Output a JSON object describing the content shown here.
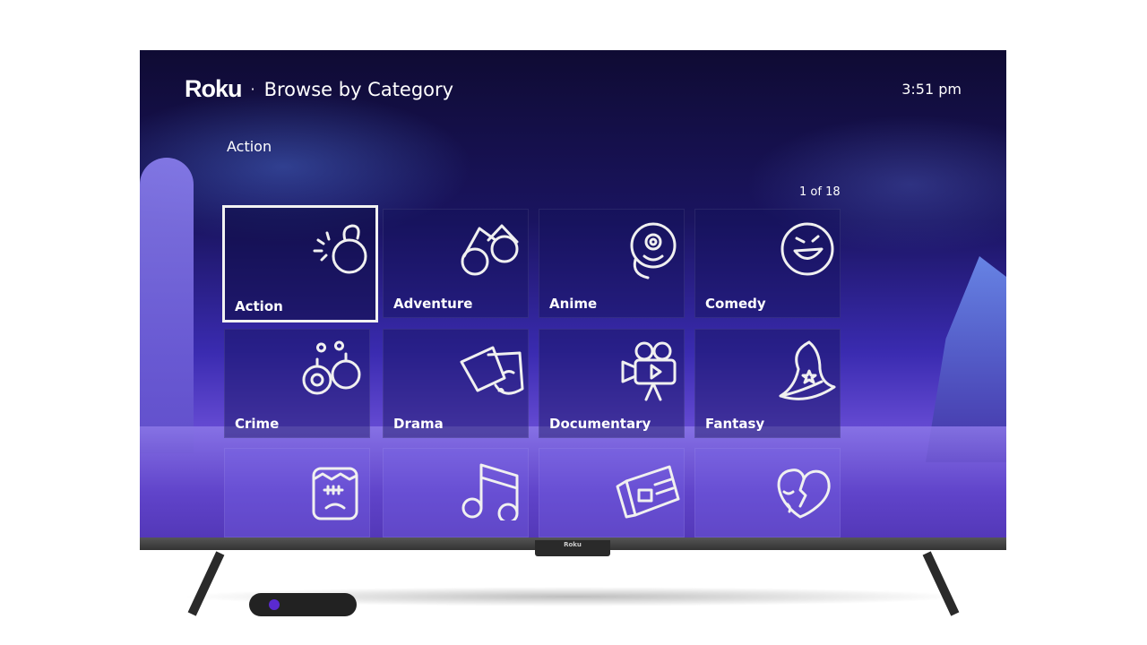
{
  "header": {
    "logo": "Roku",
    "separator": "·",
    "title": "Browse by Category",
    "clock": "3:51 pm"
  },
  "breadcrumb": "Action",
  "pager": "1 of 18",
  "tiles": [
    {
      "label": "Action",
      "icon": "bomb-icon",
      "focused": true
    },
    {
      "label": "Adventure",
      "icon": "binoculars-icon"
    },
    {
      "label": "Anime",
      "icon": "anime-creature-icon"
    },
    {
      "label": "Comedy",
      "icon": "laughing-face-icon"
    },
    {
      "label": "Crime",
      "icon": "handcuffs-icon"
    },
    {
      "label": "Drama",
      "icon": "drama-masks-icon"
    },
    {
      "label": "Documentary",
      "icon": "movie-camera-icon"
    },
    {
      "label": "Fantasy",
      "icon": "wizard-hat-icon"
    },
    {
      "label": "",
      "icon": "frankenstein-icon"
    },
    {
      "label": "",
      "icon": "music-note-icon"
    },
    {
      "label": "",
      "icon": "newspaper-icon"
    },
    {
      "label": "",
      "icon": "broken-heart-icon"
    }
  ],
  "tv": {
    "brand": "Roku"
  },
  "colors": {
    "focus_border": "#f2f2f2",
    "background_top": "#0f0b33",
    "background_bottom": "#8a6be6"
  }
}
